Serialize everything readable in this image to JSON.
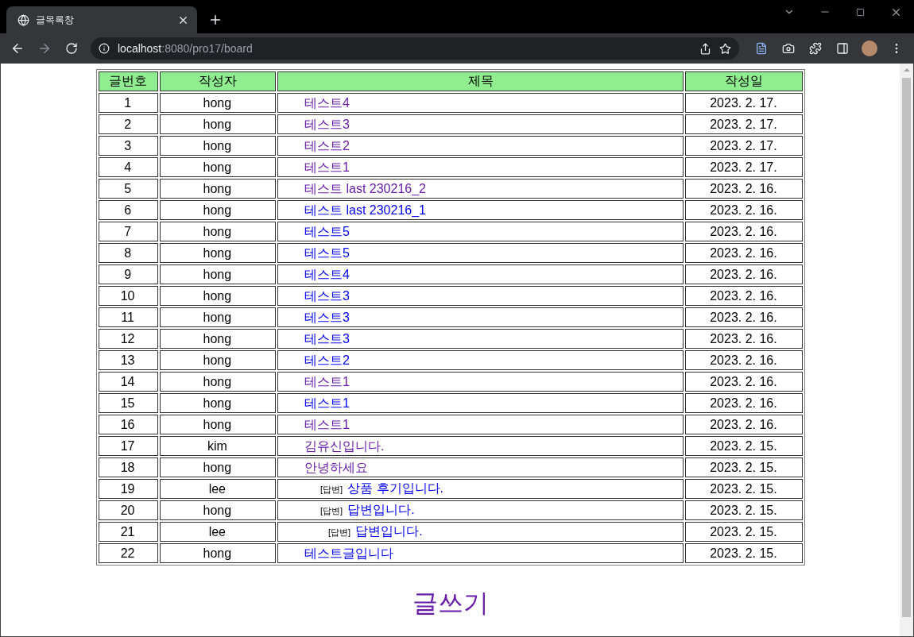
{
  "browser": {
    "tab_title": "글목록창",
    "url_host": "localhost",
    "url_path": ":8080/pro17/board"
  },
  "table": {
    "columns": [
      "글번호",
      "작성자",
      "제목",
      "작성일"
    ],
    "rows": [
      {
        "no": "1",
        "author": "hong",
        "title": "테스트4",
        "date": "2023. 2. 17.",
        "visited": true
      },
      {
        "no": "2",
        "author": "hong",
        "title": "테스트3",
        "date": "2023. 2. 17.",
        "visited": true
      },
      {
        "no": "3",
        "author": "hong",
        "title": "테스트2",
        "date": "2023. 2. 17.",
        "visited": true
      },
      {
        "no": "4",
        "author": "hong",
        "title": "테스트1",
        "date": "2023. 2. 17.",
        "visited": true
      },
      {
        "no": "5",
        "author": "hong",
        "title": "테스트 last 230216_2",
        "date": "2023. 2. 16.",
        "visited": true
      },
      {
        "no": "6",
        "author": "hong",
        "title": "테스트 last 230216_1",
        "date": "2023. 2. 16.",
        "visited": false
      },
      {
        "no": "7",
        "author": "hong",
        "title": "테스트5",
        "date": "2023. 2. 16.",
        "visited": false
      },
      {
        "no": "8",
        "author": "hong",
        "title": "테스트5",
        "date": "2023. 2. 16.",
        "visited": false
      },
      {
        "no": "9",
        "author": "hong",
        "title": "테스트4",
        "date": "2023. 2. 16.",
        "visited": false
      },
      {
        "no": "10",
        "author": "hong",
        "title": "테스트3",
        "date": "2023. 2. 16.",
        "visited": false
      },
      {
        "no": "11",
        "author": "hong",
        "title": "테스트3",
        "date": "2023. 2. 16.",
        "visited": false
      },
      {
        "no": "12",
        "author": "hong",
        "title": "테스트3",
        "date": "2023. 2. 16.",
        "visited": false
      },
      {
        "no": "13",
        "author": "hong",
        "title": "테스트2",
        "date": "2023. 2. 16.",
        "visited": false
      },
      {
        "no": "14",
        "author": "hong",
        "title": "테스트1",
        "date": "2023. 2. 16.",
        "visited": true
      },
      {
        "no": "15",
        "author": "hong",
        "title": "테스트1",
        "date": "2023. 2. 16.",
        "visited": false
      },
      {
        "no": "16",
        "author": "hong",
        "title": "테스트1",
        "date": "2023. 2. 16.",
        "visited": true
      },
      {
        "no": "17",
        "author": "kim",
        "title": "김유신입니다.",
        "date": "2023. 2. 15.",
        "visited": true
      },
      {
        "no": "18",
        "author": "hong",
        "title": "안녕하세요",
        "date": "2023. 2. 15.",
        "visited": true,
        "children": [
          {
            "no": "19",
            "author": "lee",
            "reply_label": "[답변]",
            "title": "상품 후기입니다.",
            "date": "2023. 2. 15.",
            "visited": false
          },
          {
            "no": "20",
            "author": "hong",
            "reply_label": "[답변]",
            "title": "답변입니다.",
            "date": "2023. 2. 15.",
            "visited": false,
            "children": [
              {
                "no": "21",
                "author": "lee",
                "reply_label": "[답변]",
                "title": "답변입니다.",
                "date": "2023. 2. 15.",
                "visited": false
              }
            ]
          }
        ]
      },
      {
        "no": "22",
        "author": "hong",
        "title": "테스트글입니다",
        "date": "2023. 2. 15.",
        "visited": false
      }
    ]
  },
  "write_link": {
    "label": "글쓰기",
    "visited": true
  }
}
